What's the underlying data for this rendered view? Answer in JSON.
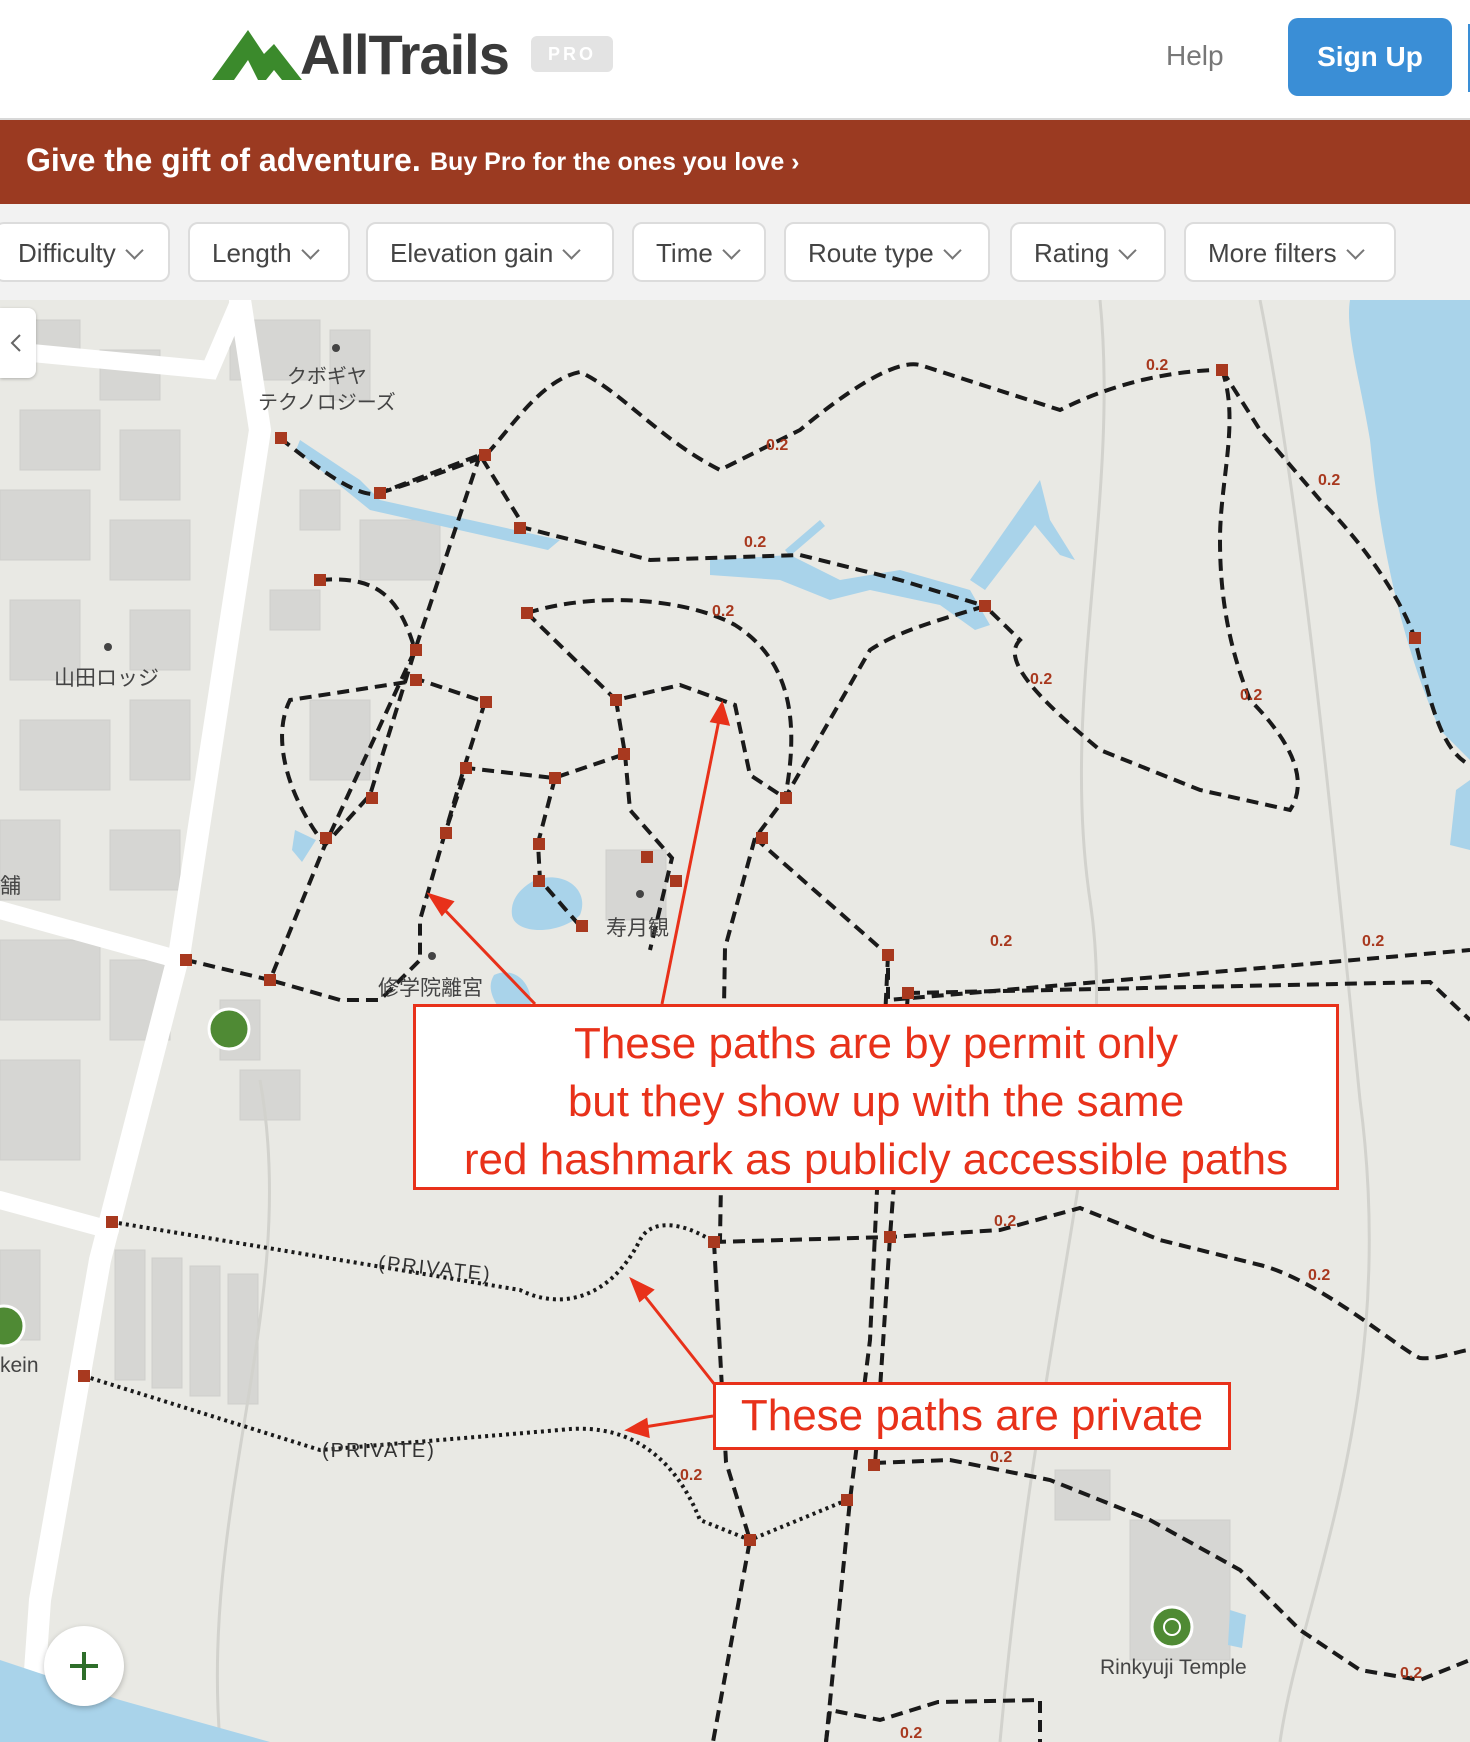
{
  "header": {
    "brand": "AllTrails",
    "pro_badge": "PRO",
    "help_link": "Help",
    "signup_button": "Sign Up",
    "logo_icon": "mountain-logo-icon",
    "brand_color": "#3a3a3a",
    "logo_color": "#3b8a2c",
    "signup_color": "#3a8ed6"
  },
  "promo": {
    "headline": "Give the gift of adventure.",
    "cta": "Buy Pro for the ones you love ›",
    "background": "#9b3a21"
  },
  "filters": [
    "Difficulty",
    "Length",
    "Elevation gain",
    "Time",
    "Route type",
    "Rating",
    "More filters"
  ],
  "map": {
    "labels": {
      "kubogiya": "クボギヤ\nテクノロジーズ",
      "yamada": "山田ロッジ",
      "jugetsukan": "寿月観",
      "shugakuin": "修学院離宮",
      "edge_shop": "舗",
      "edge_kein": "kein",
      "temple": "Rinkyuji Temple",
      "private_1": "(PRIVATE)",
      "private_2": "(PRIVATE)",
      "dist_02": "0.2"
    },
    "water_color": "#a9d3ea",
    "trail_color": "#1a1a1a",
    "marker_color": "#a8391f"
  },
  "annotations": {
    "permit": [
      "These paths are by permit only",
      "but they show up with the same",
      "red hashmark as publicly accessible paths"
    ],
    "private": "These paths are private",
    "color": "#e8311a"
  },
  "controls": {
    "collapse_icon": "chevron-left-icon",
    "zoom_icon": "plus-icon"
  }
}
